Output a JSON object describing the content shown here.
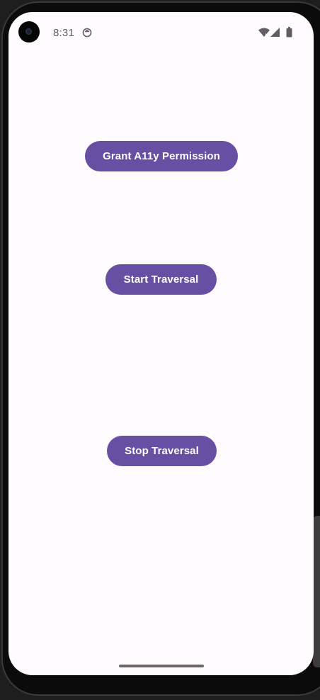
{
  "status_bar": {
    "time": "8:31",
    "icons": [
      "data-sync-icon",
      "wifi-icon",
      "signal-icon",
      "battery-icon"
    ]
  },
  "main": {
    "buttons": [
      {
        "label": "Grant A11y Permission"
      },
      {
        "label": "Start Traversal"
      },
      {
        "label": "Stop Traversal"
      }
    ]
  },
  "colors": {
    "primary": "#6750a4",
    "background": "#fffbfe",
    "on_primary": "#ffffff"
  }
}
